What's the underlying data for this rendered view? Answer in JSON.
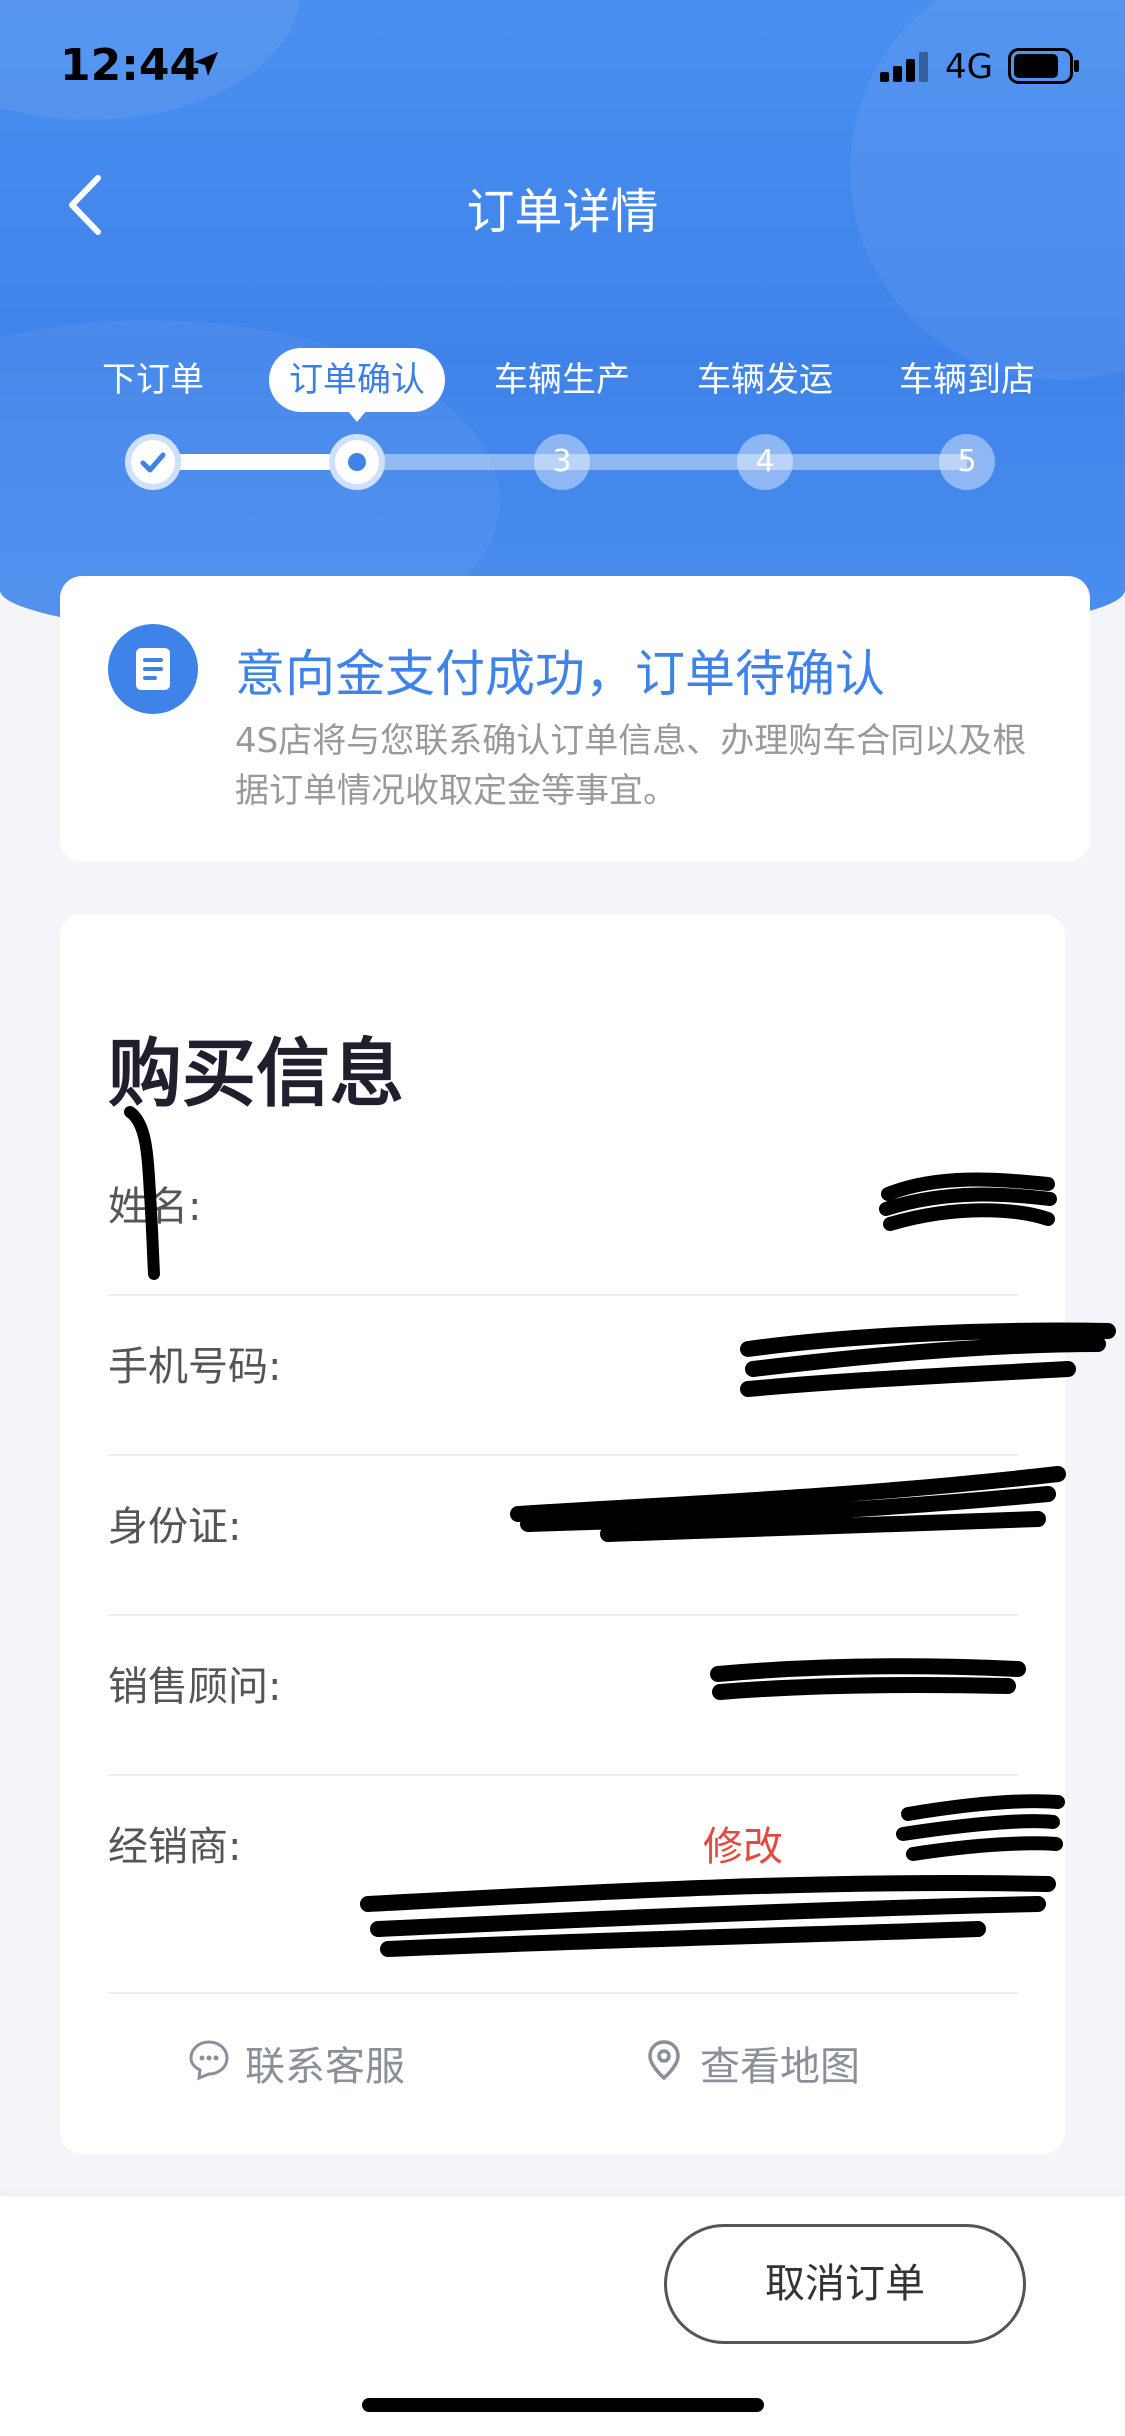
{
  "status_bar": {
    "time": "12:44",
    "network": "4G"
  },
  "nav": {
    "title": "订单详情"
  },
  "steps": [
    {
      "label": "下订单",
      "number": "1",
      "state": "done"
    },
    {
      "label": "订单确认",
      "number": "2",
      "state": "current"
    },
    {
      "label": "车辆生产",
      "number": "3",
      "state": "pending"
    },
    {
      "label": "车辆发运",
      "number": "4",
      "state": "pending"
    },
    {
      "label": "车辆到店",
      "number": "5",
      "state": "pending"
    }
  ],
  "notice": {
    "title": "意向金支付成功，订单待确认",
    "description": "4S店将与您联系确认订单信息、办理购车合同以及根据订单情况收取定金等事宜。"
  },
  "purchase_info": {
    "title": "购买信息",
    "fields": [
      {
        "label": "姓名:"
      },
      {
        "label": "手机号码:"
      },
      {
        "label": "身份证:"
      },
      {
        "label": "销售顾问:"
      },
      {
        "label": "经销商:"
      }
    ],
    "edit_label": "修改",
    "contact_service": "联系客服",
    "view_map": "查看地图"
  },
  "footer": {
    "cancel_label": "取消订单"
  },
  "colors": {
    "primary": "#3f83ea",
    "edit": "#e44a3d"
  }
}
